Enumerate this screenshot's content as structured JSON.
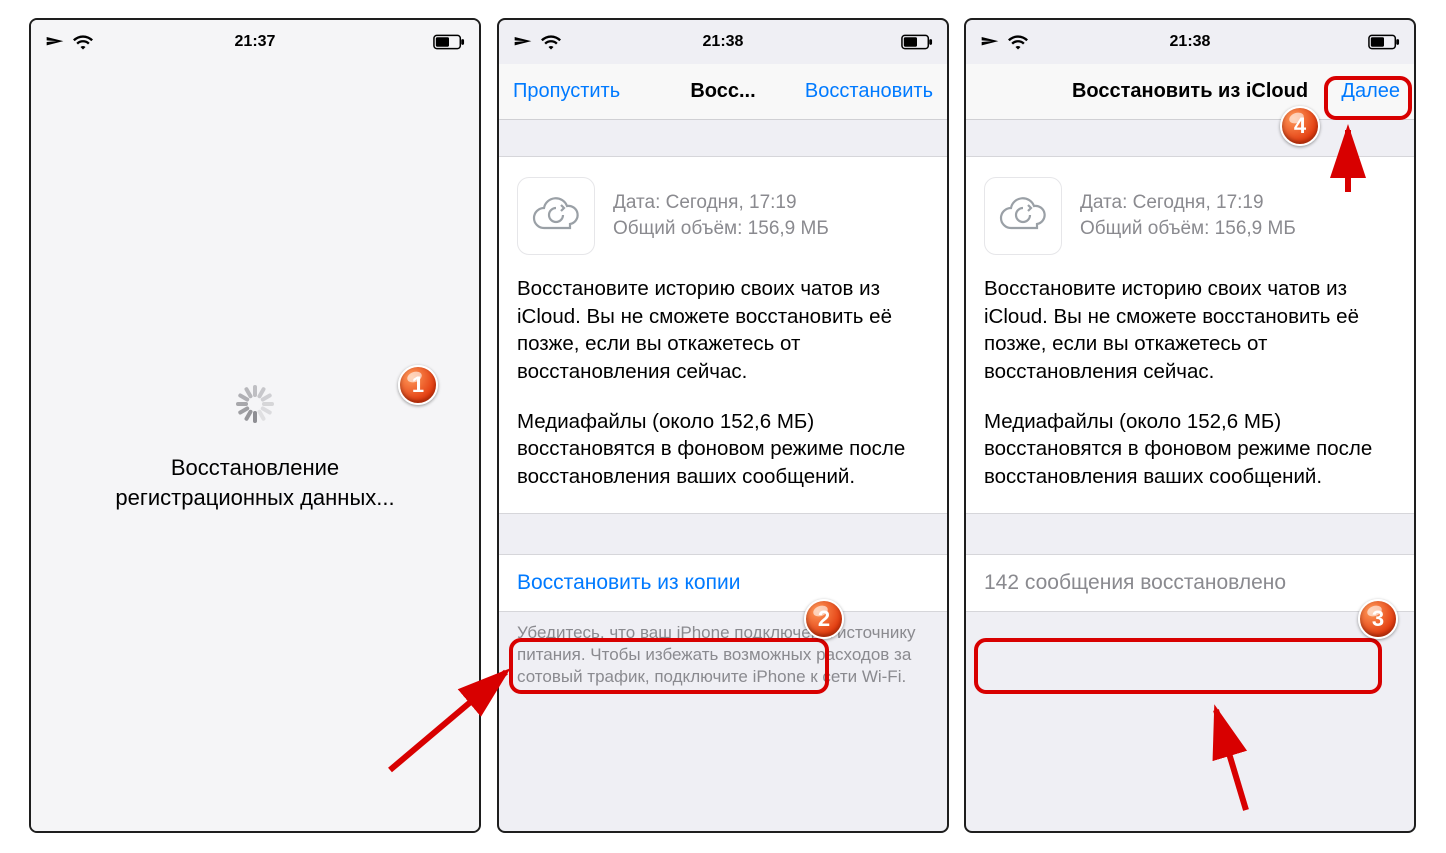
{
  "screens": {
    "s1": {
      "time": "21:37",
      "loading_text": "Восстановление\nрегистрационных данных..."
    },
    "s2": {
      "time": "21:38",
      "nav_left": "Пропустить",
      "nav_title": "Восс...",
      "nav_right": "Восстановить",
      "meta_line1": "Дата: Сегодня, 17:19",
      "meta_line2": "Общий объём: 156,9 МБ",
      "para1": "Восстановите историю своих чатов из iCloud. Вы не сможете восстановить её позже, если вы откажетесь от восстановления сейчас.",
      "para2": "Медиафайлы (около 152,6 МБ) восстановятся в фоновом режиме после восстановления ваших сообщений.",
      "action": "Восстановить из копии",
      "footer": "Убедитесь, что ваш iPhone подключен к источнику питания. Чтобы избежать возможных расходов за сотовый трафик, подключите iPhone к сети Wi-Fi."
    },
    "s3": {
      "time": "21:38",
      "nav_title": "Восстановить из iCloud",
      "nav_right": "Далее",
      "meta_line1": "Дата: Сегодня, 17:19",
      "meta_line2": "Общий объём: 156,9 МБ",
      "para1": "Восстановите историю своих чатов из iCloud. Вы не сможете восстановить её позже, если вы откажетесь от восстановления сейчас.",
      "para2": "Медиафайлы (около 152,6 МБ) восстановятся в фоновом режиме после восстановления ваших сообщений.",
      "status": "142 сообщения восстановлено"
    }
  },
  "badges": {
    "b1": "1",
    "b2": "2",
    "b3": "3",
    "b4": "4"
  }
}
